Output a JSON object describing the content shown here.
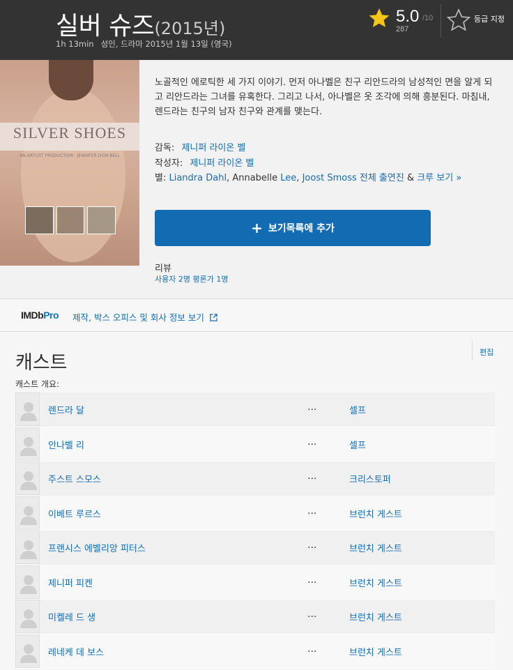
{
  "header": {
    "title": "실버 슈즈",
    "year": "(2015년)",
    "runtime": "1h 13min",
    "certificate": "성인,",
    "genre": "드라마",
    "release": "2015년 1월 13일",
    "country": "(영국)",
    "rating_value": "5.0",
    "rating_outof": "/10",
    "rating_votes": "287",
    "rate_label": "등급 지정"
  },
  "poster": {
    "title": "SILVER SHOES",
    "credit": "AN ARTLIST PRODUCTION · JENNIFER LYON BELL"
  },
  "overview": {
    "plot": "노골적인 에로틱한 세 가지 이야기. 먼저 아나벨은 친구 리안드라의 남성적인 면을 알게 되고 리안드라는 그녀를 유혹한다. 그리고 나서, 아나벨은 옷 조각에 의해 흥분된다. 마침내, 렌드라는 친구의 남자 친구와 관계를 맺는다.",
    "director_label": "감독:",
    "director": "제니퍼 라이온 벨",
    "writer_label": "작성자:",
    "writer": "제니퍼 라이온 벨",
    "stars_label": "별:",
    "star1": "Liandra Dahl",
    "star_sep1": ", Annabelle ",
    "star2": "Lee",
    "star_sep2": ", ",
    "star3": "Joost Smoss 전체 출연진",
    "star_sep3": " & ",
    "star_more": "크루 보기 »",
    "watchlist_button": "보기목록에 추가",
    "reviews_heading": "리뷰",
    "reviews_link": "사용자 2명 평론가 1명"
  },
  "pro": {
    "logo_imdb": "IMDb",
    "logo_pro": "Pro",
    "link": "제작, 박스 오피스 및 회사 정보 보기"
  },
  "cast": {
    "title": "캐스트",
    "edit": "편집",
    "subtitle": "캐스트 개요:",
    "ellipsis": "...",
    "rows": [
      {
        "actor": "렌드라 달",
        "character": "셀프"
      },
      {
        "actor": "안나벨 리",
        "character": "셀프"
      },
      {
        "actor": "주스트 스모스",
        "character": "크리스토퍼"
      },
      {
        "actor": "이베트 루르스",
        "character": "브런치 게스트"
      },
      {
        "actor": "프랜시스 에벨리앙 피터스",
        "character": "브런치 게스트"
      },
      {
        "actor": "제니퍼 피켄",
        "character": "브런치 게스트"
      },
      {
        "actor": "미켈레 드 생",
        "character": "브런치 게스트"
      },
      {
        "actor": "레네케 데 보스",
        "character": "브런치 게스트"
      }
    ]
  },
  "colors": {
    "header_bg": "#333333",
    "link_blue": "#136cb2",
    "star_yellow": "#f5c518"
  }
}
